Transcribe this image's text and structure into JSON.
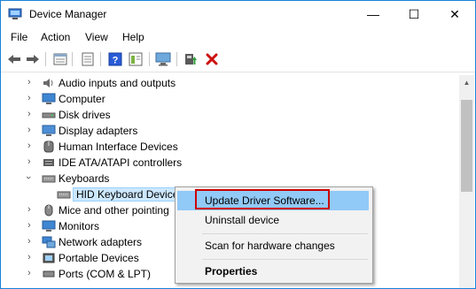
{
  "window": {
    "title": "Device Manager"
  },
  "title_buttons": {
    "minimize": "—",
    "maximize": "☐",
    "close": "✕"
  },
  "menu": [
    "File",
    "Action",
    "View",
    "Help"
  ],
  "toolbar": [
    "back-arrow-icon",
    "forward-arrow-icon",
    "properties-icon",
    "show-all-icon",
    "help-icon",
    "action-pane-icon",
    "monitor-scan-icon",
    "update-driver-icon",
    "uninstall-x-icon"
  ],
  "tree": {
    "items": [
      {
        "label": "Audio inputs and outputs",
        "icon": "speaker-icon",
        "expanded": false
      },
      {
        "label": "Computer",
        "icon": "computer-icon",
        "expanded": false
      },
      {
        "label": "Disk drives",
        "icon": "disk-drive-icon",
        "expanded": false
      },
      {
        "label": "Display adapters",
        "icon": "display-adapter-icon",
        "expanded": false
      },
      {
        "label": "Human Interface Devices",
        "icon": "hid-icon",
        "expanded": false
      },
      {
        "label": "IDE ATA/ATAPI controllers",
        "icon": "ide-controller-icon",
        "expanded": false
      },
      {
        "label": "Keyboards",
        "icon": "keyboard-icon",
        "expanded": true
      },
      {
        "label": "HID Keyboard Device",
        "icon": "keyboard-icon",
        "child": true,
        "selected": true
      },
      {
        "label": "Mice and other pointing",
        "icon": "mouse-icon",
        "expanded": false
      },
      {
        "label": "Monitors",
        "icon": "monitor-icon",
        "expanded": false
      },
      {
        "label": "Network adapters",
        "icon": "network-icon",
        "expanded": false
      },
      {
        "label": "Portable Devices",
        "icon": "portable-device-icon",
        "expanded": false
      },
      {
        "label": "Ports (COM & LPT)",
        "icon": "port-icon",
        "expanded": false
      }
    ]
  },
  "context_menu": {
    "update": "Update Driver Software...",
    "uninstall": "Uninstall device",
    "scan": "Scan for hardware changes",
    "properties": "Properties"
  },
  "colors": {
    "accent": "#1883d7",
    "highlight": "#91c9f7",
    "callout": "#cc0000",
    "delete": "#cc1010"
  }
}
